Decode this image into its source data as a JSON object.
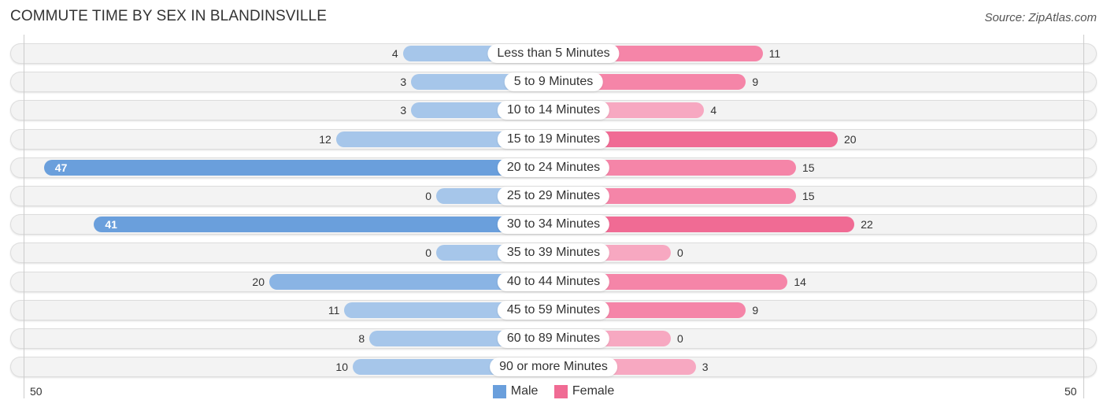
{
  "header": {
    "title": "COMMUTE TIME BY SEX IN BLANDINSVILLE",
    "source": "Source: ZipAtlas.com"
  },
  "colors": {
    "male": "#6a9fdc",
    "male_light": "#a6c6ea",
    "female": "#f06b94",
    "female_light": "#f7a8c1"
  },
  "chart_data": {
    "type": "bar",
    "orientation": "horizontal-diverging",
    "title": "COMMUTE TIME BY SEX IN BLANDINSVILLE",
    "categories": [
      "Less than 5 Minutes",
      "5 to 9 Minutes",
      "10 to 14 Minutes",
      "15 to 19 Minutes",
      "20 to 24 Minutes",
      "25 to 29 Minutes",
      "30 to 34 Minutes",
      "35 to 39 Minutes",
      "40 to 44 Minutes",
      "45 to 59 Minutes",
      "60 to 89 Minutes",
      "90 or more Minutes"
    ],
    "series": [
      {
        "name": "Male",
        "values": [
          4,
          3,
          3,
          12,
          47,
          0,
          41,
          0,
          20,
          11,
          8,
          10
        ]
      },
      {
        "name": "Female",
        "values": [
          11,
          9,
          4,
          20,
          15,
          15,
          22,
          0,
          14,
          9,
          0,
          3
        ]
      }
    ],
    "xlim": [
      50,
      50
    ],
    "axis_ticks": {
      "left": "50",
      "right": "50"
    },
    "legend": {
      "position": "bottom-center",
      "entries": [
        "Male",
        "Female"
      ]
    },
    "grid": false
  }
}
